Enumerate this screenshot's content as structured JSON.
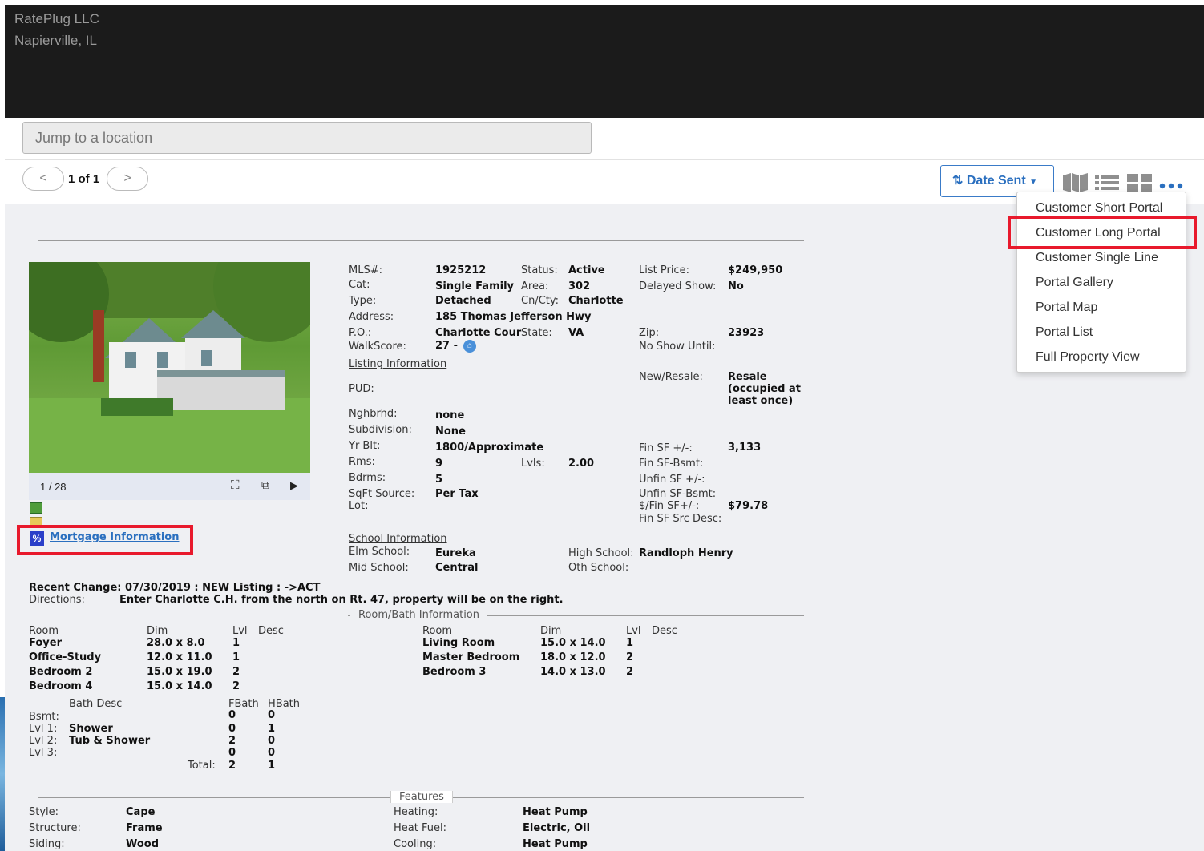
{
  "header": {
    "company": "RatePlug LLC",
    "city": "Napierville, IL"
  },
  "jump": {
    "placeholder": "Jump to a location"
  },
  "pager": {
    "prev": "<",
    "next": ">",
    "count": "1 of 1"
  },
  "sort": {
    "label": "Date Sent"
  },
  "menu": {
    "items": [
      "Customer Short Portal",
      "Customer Long Portal",
      "Customer Single Line",
      "Portal Gallery",
      "Portal Map",
      "Portal List",
      "Full Property View"
    ]
  },
  "photo": {
    "counter": "1 / 28"
  },
  "mortgage_link": "Mortgage Information",
  "listing": {
    "mls_label": "MLS#:",
    "mls": "1925212",
    "status_label": "Status:",
    "status": "Active",
    "price_label": "List Price:",
    "price": "$249,950",
    "cat_label": "Cat:",
    "cat": "Single Family",
    "area_label": "Area:",
    "area": "302",
    "delayed_label": "Delayed Show:",
    "delayed": "No",
    "type_label": "Type:",
    "type": "Detached",
    "cncty_label": "Cn/Cty:",
    "cncty": "Charlotte",
    "address_label": "Address:",
    "address": "185 Thomas Jefferson Hwy",
    "po_label": "P.O.:",
    "po": "Charlotte Cour",
    "state_label": "State:",
    "state": "VA",
    "zip_label": "Zip:",
    "zip": "23923",
    "walk_label": "WalkScore:",
    "walk": "27 -",
    "noshow_label": "No Show Until:",
    "listing_info": "Listing Information",
    "newresale_label": "New/Resale:",
    "newresale_1": "Resale",
    "newresale_2": "(occupied at",
    "newresale_3": "least once)",
    "pud_label": "PUD:",
    "nghbrhd_label": "Nghbrhd:",
    "nghbrhd": "none",
    "subdiv_label": "Subdivision:",
    "subdiv": "None",
    "yrblt_label": "Yr Blt:",
    "yrblt": "1800/Approximate",
    "finsf_label": "Fin SF +/-:",
    "finsf": "3,133",
    "rms_label": "Rms:",
    "rms": "9",
    "lvls_label": "Lvls:",
    "lvls": "2.00",
    "finsfbsmt_label": "Fin SF-Bsmt:",
    "bdrms_label": "Bdrms:",
    "bdrms": "5",
    "unfinsf_label": "Unfin SF +/-:",
    "sqft_label": "SqFt Source:",
    "sqft": "Per Tax",
    "unfinbsmt_label": "Unfin SF-Bsmt:",
    "lot_label": "Lot:",
    "perfinsf_label": "$/Fin SF+/-:",
    "perfinsf": "$79.78",
    "finsrc_label": "Fin SF Src Desc:",
    "school_info": "School Information",
    "elm_label": "Elm School:",
    "elm": "Eureka",
    "high_label": "High School:",
    "high": "Randloph Henry",
    "mid_label": "Mid School:",
    "mid": "Central",
    "oth_label": "Oth School:"
  },
  "recent_change": "Recent Change: 07/30/2019 : NEW Listing : ->ACT",
  "directions_label": "Directions:",
  "directions": "Enter Charlotte C.H. from the north on Rt. 47, property will be on the right.",
  "rooms_title": "Room/Bath Information",
  "rooms_headers": {
    "room": "Room",
    "dim": "Dim",
    "lvl": "Lvl",
    "desc": "Desc"
  },
  "rooms_left": [
    {
      "room": "Foyer",
      "dim": "28.0 x 8.0",
      "lvl": "1"
    },
    {
      "room": "Office-Study",
      "dim": "12.0 x 11.0",
      "lvl": "1"
    },
    {
      "room": "Bedroom 2",
      "dim": "15.0 x 19.0",
      "lvl": "2"
    },
    {
      "room": "Bedroom 4",
      "dim": "15.0 x 14.0",
      "lvl": "2"
    }
  ],
  "rooms_right": [
    {
      "room": "Living Room",
      "dim": "15.0 x 14.0",
      "lvl": "1"
    },
    {
      "room": "Master Bedroom",
      "dim": "18.0 x 12.0",
      "lvl": "2"
    },
    {
      "room": "Bedroom 3",
      "dim": "14.0 x 13.0",
      "lvl": "2"
    }
  ],
  "bath_headers": {
    "desc": "Bath Desc",
    "fbath": "FBath",
    "hbath": "HBath"
  },
  "baths": [
    {
      "lvl": "Bsmt:",
      "desc": "",
      "f": "0",
      "h": "0"
    },
    {
      "lvl": "Lvl 1:",
      "desc": "Shower",
      "f": "0",
      "h": "1"
    },
    {
      "lvl": "Lvl 2:",
      "desc": "Tub & Shower",
      "f": "2",
      "h": "0"
    },
    {
      "lvl": "Lvl 3:",
      "desc": "",
      "f": "0",
      "h": "0"
    }
  ],
  "bath_total": {
    "label": "Total:",
    "f": "2",
    "h": "1"
  },
  "features_title": "Features",
  "features_left": [
    {
      "label": "Style:",
      "value": "Cape"
    },
    {
      "label": "Structure:",
      "value": "Frame"
    },
    {
      "label": "Siding:",
      "value": "Wood"
    }
  ],
  "features_right": [
    {
      "label": "Heating:",
      "value": "Heat Pump"
    },
    {
      "label": "Heat Fuel:",
      "value": "Electric, Oil"
    },
    {
      "label": "Cooling:",
      "value": "Heat Pump"
    }
  ],
  "colors": {
    "accent": "#2a6fbf",
    "highlight": "#e8192c",
    "header": "#1b1b1b"
  }
}
